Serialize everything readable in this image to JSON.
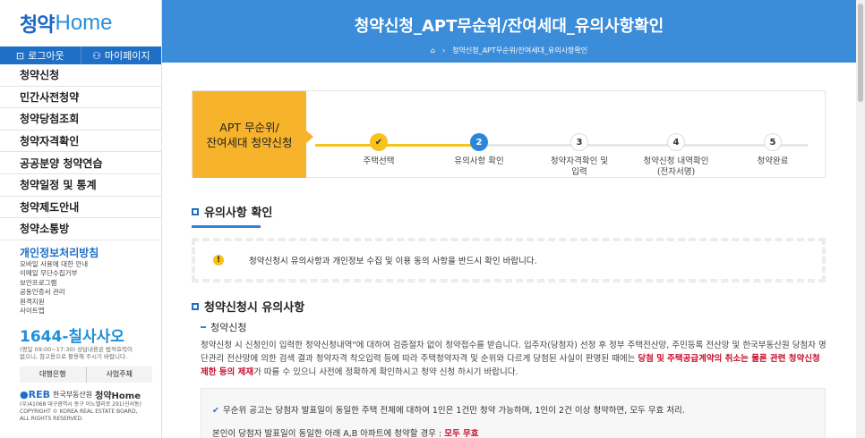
{
  "sidebar": {
    "logo_ko": "청약",
    "logo_en": "Home",
    "logout": "로그아웃",
    "mypage": "마이페이지",
    "menu": [
      "청약신청",
      "민간사전청약",
      "청약당첨조회",
      "청약자격확인",
      "공공분양 청약연습",
      "청약일정 및 통계",
      "청약제도안내",
      "청약소통방"
    ],
    "privacy_title": "개인정보처리방침",
    "privacy_lines": [
      "모바일 사용에 대한 안내",
      "이메일 무단수집거부",
      "보안프로그램",
      "공동인증서 관리",
      "원격지원",
      "사이트맵"
    ],
    "phone": "1644-칠사사오",
    "phone_sub1": "(평일 09:00~17:30) 상담내용은 법적효력이",
    "phone_sub2": "없으니, 참고용으로 활용해 주시기 바랍니다.",
    "link1": "대행은행",
    "link2": "사업주체",
    "footer_org": "한국부동산원",
    "footer_logo": "청약Home",
    "footer_addr": "(우)41068 대구광역시 동구 이노밸리로 291(신서동)",
    "footer_copy1": "COPYRIGHT © KOREA REAL ESTATE BOARD,",
    "footer_copy2": "ALL RIGHTS RESERVED."
  },
  "header": {
    "title": "청약신청_APT무순위/잔여세대_유의사항확인",
    "breadcrumb": "청약신청_APT무순위/잔여세대_유의사항확인"
  },
  "stepper": {
    "label_line1": "APT 무순위/",
    "label_line2": "잔여세대 청약신청",
    "steps": [
      {
        "num": "✔",
        "text1": "주택선택",
        "text2": ""
      },
      {
        "num": "2",
        "text1": "유의사항 확인",
        "text2": ""
      },
      {
        "num": "3",
        "text1": "청약자격확인 및",
        "text2": "입력"
      },
      {
        "num": "4",
        "text1": "청약신청 내역확인",
        "text2": "(전자서명)"
      },
      {
        "num": "5",
        "text1": "청약완료",
        "text2": ""
      }
    ]
  },
  "section1": {
    "title": "유의사항 확인",
    "notice": "청약신청시 유의사항과 개인정보 수집 및 이용 동의 사항을 반드시 확인 바랍니다."
  },
  "section2": {
    "title": "청약신청시 유의사항",
    "subtitle": "청약신청",
    "para_a": "청약신청 시 신청인이 입력한 청약신청내역\"에 대하여 검증절차 없이 청약접수를 받습니다. 입주자(당첨자) 선정 후 정부 주택전산망, 주민등록 전산망 및 한국부동산원 당첨자 명단관리 전산망에 의한 검색 결과 청약자격 착오입력 등에 따라 주택청약자격 및 순위와 다르게 당첨된 사실이 판명된 때에는 ",
    "para_red": "당첨 및 주택공급계약의 취소는 물론 관련 청약신청 제한 등의 제재",
    "para_b": "가 따를 수 있으니 사전에 정확하게 확인하시고 청약 신청 하시기 바랍니다.",
    "box_line1": "무순위 공고는 당첨자 발표일이 동일한 주택 전체에 대하여 1인은 1건만 청약 가능하며, 1인이 2건 이상 청약하면, 모두 무효 처리.",
    "box_line2": "본인이 당첨자 발표일이 동일한 아래 A,B 아파트에 청약할 경우 : ",
    "box_line2_red": "모두 무효"
  }
}
